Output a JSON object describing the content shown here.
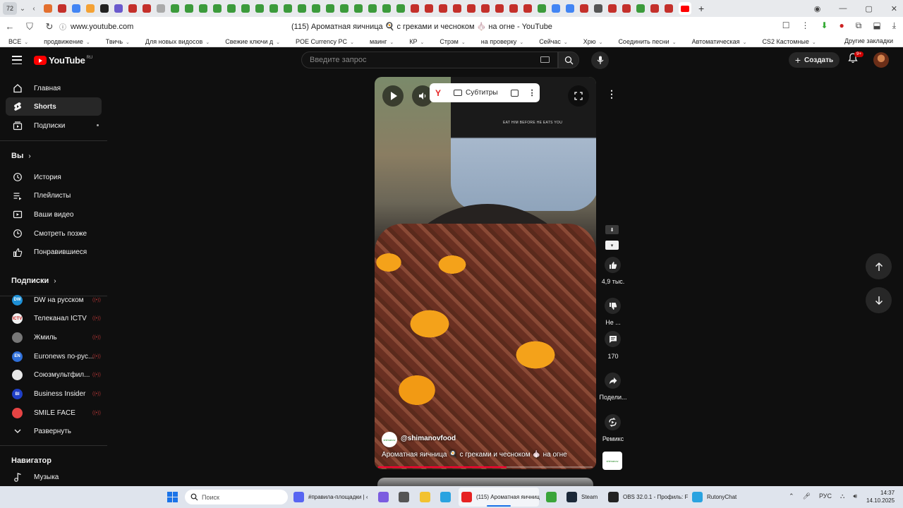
{
  "browser": {
    "tab_count": "72",
    "url": "www.youtube.com",
    "page_title": "(115) Ароматная яичница 🍳 с греками и чесноком 🧄 на огне - YouTube",
    "bookmarks": [
      {
        "label": "ВСЕ"
      },
      {
        "label": "продвижение"
      },
      {
        "label": "Твичь"
      },
      {
        "label": "Для новых видосов"
      },
      {
        "label": "Свежие ключи д"
      },
      {
        "label": "POE Currency PC"
      },
      {
        "label": "маинг"
      },
      {
        "label": "КР"
      },
      {
        "label": "Стрэм"
      },
      {
        "label": "на проверку"
      },
      {
        "label": "Сейчас"
      },
      {
        "label": "Хрю"
      },
      {
        "label": "Соединить песни"
      },
      {
        "label": "Автоматическая"
      },
      {
        "label": "CS2 Кастомные"
      }
    ],
    "other_bookmarks": "Другие закладки"
  },
  "youtube": {
    "logo_text": "YouTube",
    "logo_region": "RU",
    "search_placeholder": "Введите запрос",
    "create_label": "Создать",
    "notifications_badge": "9+",
    "sidebar": {
      "main": [
        {
          "label": "Главная",
          "icon": "home-icon"
        },
        {
          "label": "Shorts",
          "icon": "shorts-icon"
        },
        {
          "label": "Подписки",
          "icon": "subscriptions-icon"
        }
      ],
      "you_header": "Вы",
      "you": [
        {
          "label": "История",
          "icon": "history-icon"
        },
        {
          "label": "Плейлисты",
          "icon": "playlists-icon"
        },
        {
          "label": "Ваши видео",
          "icon": "your-videos-icon"
        },
        {
          "label": "Смотреть позже",
          "icon": "watch-later-icon"
        },
        {
          "label": "Понравившиеся",
          "icon": "liked-icon"
        }
      ],
      "subs_header": "Подписки",
      "subscriptions": [
        {
          "label": "DW на русском",
          "color": "#1e90d6",
          "initials": "DW"
        },
        {
          "label": "Телеканал ICTV",
          "color": "#f1f1f1",
          "initials": "ICTV"
        },
        {
          "label": "Жмиль",
          "color": "#777777",
          "initials": ""
        },
        {
          "label": "Euronews по-рус...",
          "color": "#2f6fd8",
          "initials": "EN"
        },
        {
          "label": "Союзмультфил...",
          "color": "#e8e8e8",
          "initials": ""
        },
        {
          "label": "Business Insider",
          "color": "#1f3fc7",
          "initials": "BI"
        },
        {
          "label": "SMILE FACE",
          "color": "#e64444",
          "initials": ""
        }
      ],
      "expand_label": "Развернуть",
      "navigator_header": "Навигатор",
      "navigator": [
        {
          "label": "Музыка",
          "icon": "music-icon"
        }
      ]
    },
    "short": {
      "channel": "@shimanovfood",
      "channel_logo_text": "shimanov",
      "title": "Ароматная яичница 🍳 с греками и чесноком 🧄 на огне",
      "shirt_text": "EAT HIM BEFORE HE EATS YOU",
      "subtitles_label": "Субтитры",
      "progress": 0.6
    },
    "actions": {
      "likes": "4,9 тыс.",
      "dislike": "Не ...",
      "comments": "170",
      "share": "Подели...",
      "remix": "Ремикс"
    }
  },
  "taskbar": {
    "search_placeholder": "Поиск",
    "apps": [
      {
        "label": "#правила-площадки | ‹",
        "color": "#5865f2"
      },
      {
        "label": "",
        "color": "#7b5ce0"
      },
      {
        "label": "",
        "color": "#555555"
      },
      {
        "label": "",
        "color": "#f2c230"
      },
      {
        "label": "",
        "color": "#2aa3e0"
      },
      {
        "label": "(115) Ароматная яичниц",
        "color": "#e62222"
      },
      {
        "label": "",
        "color": "#3aa53a"
      },
      {
        "label": "Steam",
        "color": "#1b2838"
      },
      {
        "label": "OBS 32.0.1 - Профиль: F",
        "color": "#222222"
      },
      {
        "label": "RutonyChat",
        "color": "#2aa3e0"
      }
    ],
    "lang": "РУС",
    "time": "14:37",
    "date": "14.10.2025"
  }
}
